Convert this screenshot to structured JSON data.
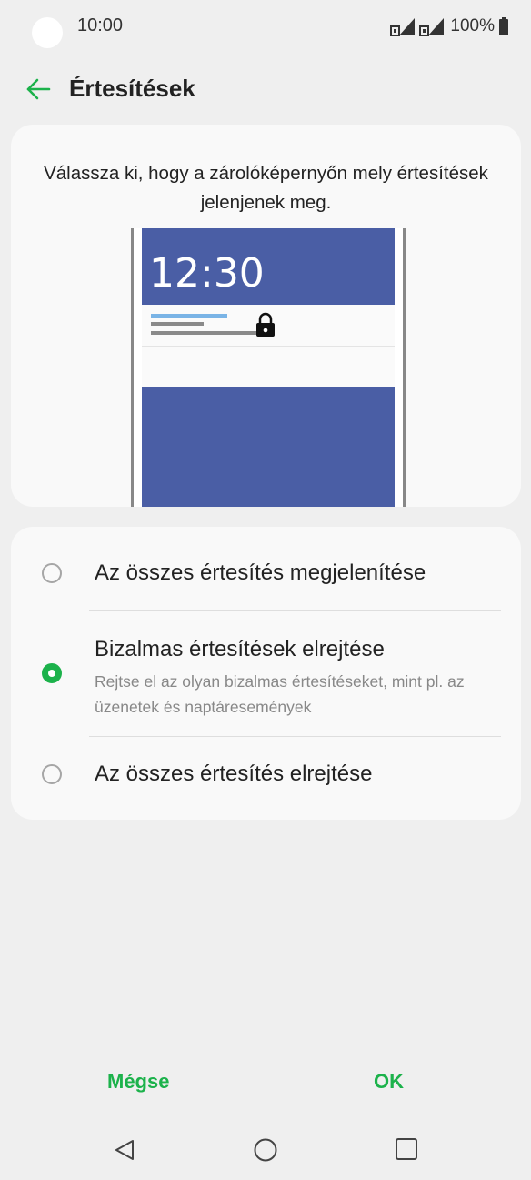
{
  "status_bar": {
    "time": "10:00",
    "battery": "100%"
  },
  "header": {
    "back_icon": "arrow-left-icon",
    "title": "Értesítések"
  },
  "preview_card": {
    "description": "Válassza ki, hogy a zárolóképernyőn mely értesítések jelenjenek meg.",
    "clock": "12:30",
    "lock_icon": "lock-icon"
  },
  "options": [
    {
      "label": "Az összes értesítés megjelenítése",
      "subtitle": "",
      "selected": false
    },
    {
      "label": "Bizalmas értesítések elrejtése",
      "subtitle": "Rejtse el az olyan bizalmas értesítéseket, mint pl. az üzenetek és naptáresemények",
      "selected": true
    },
    {
      "label": "Az összes értesítés elrejtése",
      "subtitle": "",
      "selected": false
    }
  ],
  "buttons": {
    "cancel": "Mégse",
    "ok": "OK"
  },
  "nav": {
    "back": "triangle-back-icon",
    "home": "circle-home-icon",
    "recents": "square-recents-icon"
  },
  "colors": {
    "accent": "#1cb24b",
    "background": "#efefef",
    "card": "#f9f9f9",
    "preview_blue": "#4a5ea5"
  }
}
